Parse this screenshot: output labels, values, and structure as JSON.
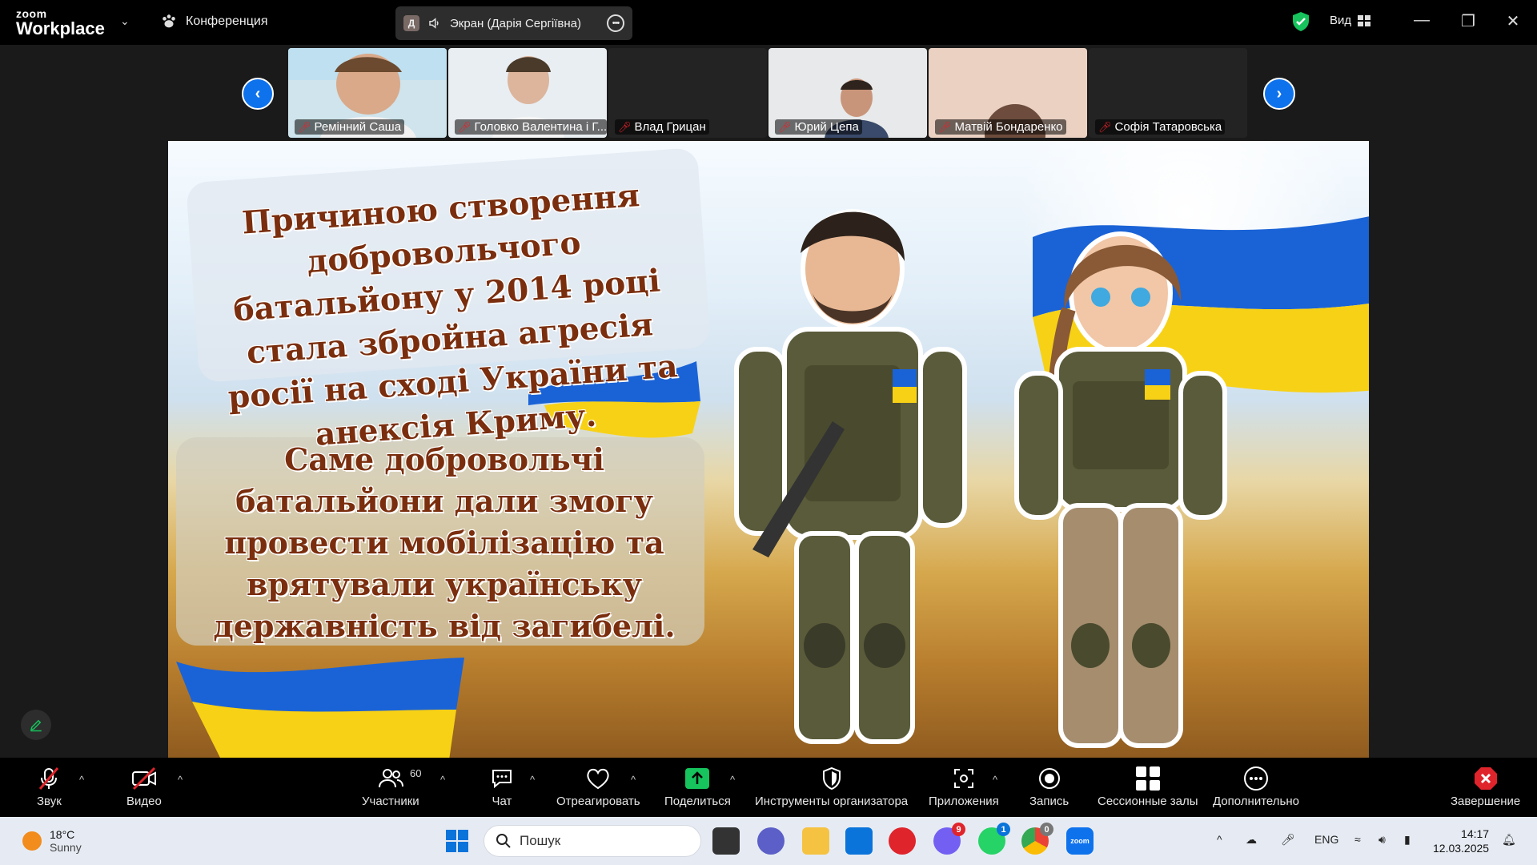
{
  "app": {
    "logo_line1": "zoom",
    "logo_line2": "Workplace",
    "meeting_title": "Конференция",
    "share_badge": "Д",
    "share_label": "Экран (Дарія Сергіївна)",
    "view_label": "Вид"
  },
  "participants": [
    {
      "name": "Ремінний Саша",
      "has_video": true
    },
    {
      "name": "Головко Валентина і Г...",
      "has_video": true
    },
    {
      "name": "Влад Грицан",
      "has_video": false
    },
    {
      "name": "Юрий Цепа",
      "has_video": true
    },
    {
      "name": "Матвій Бондаренко",
      "has_video": true
    },
    {
      "name": "Софія Татаровська",
      "has_video": false
    }
  ],
  "slide": {
    "text1": "Причиною створення добровольчого батальйону у 2014 році стала збройна агресія росії на сході України та анексія Криму.",
    "text2": "Саме добровольчі батальйони дали змогу провести мобілізацію та врятували українську державність від загибелі."
  },
  "toolbar": {
    "audio": "Звук",
    "video": "Видео",
    "participants": "Участники",
    "participants_count": "60",
    "chat": "Чат",
    "react": "Отреагировать",
    "share": "Поделиться",
    "host_tools": "Инструменты организатора",
    "apps": "Приложения",
    "record": "Запись",
    "breakout": "Сессионные залы",
    "more": "Дополнительно",
    "end": "Завершение"
  },
  "taskbar": {
    "weather_temp": "18°C",
    "weather_desc": "Sunny",
    "search_placeholder": "Пошук",
    "viber_badge": "9",
    "whatsapp_badge": "1",
    "chrome_badge": "0",
    "lang": "ENG",
    "time": "14:17",
    "date": "12.03.2025"
  },
  "colors": {
    "zoom_blue": "#0e72ed",
    "mute_red": "#e0242b",
    "share_green": "#16c35c",
    "slide_text": "#7a2e0e",
    "flag_blue": "#1a63d6",
    "flag_yellow": "#f7d116"
  }
}
